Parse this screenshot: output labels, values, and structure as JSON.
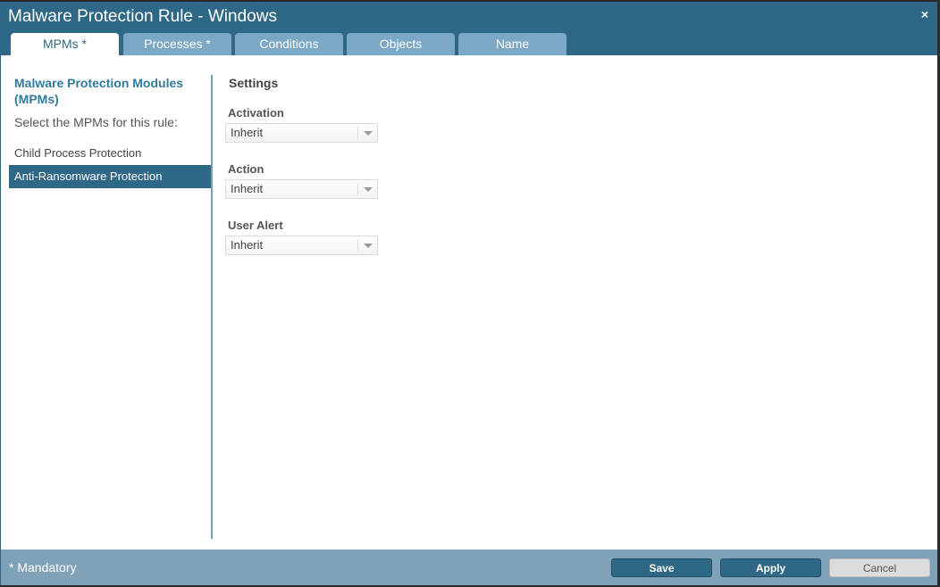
{
  "title": "Malware Protection Rule - Windows",
  "close": "×",
  "tabs": [
    "MPMs *",
    "Processes *",
    "Conditions",
    "Objects",
    "Name"
  ],
  "left": {
    "heading": "Malware Protection Modules (MPMs)",
    "subtitle": "Select the MPMs for this rule:",
    "items": [
      "Child Process Protection",
      "Anti-Ransomware Protection"
    ]
  },
  "settings": {
    "heading": "Settings",
    "fields": [
      {
        "label": "Activation",
        "value": "Inherit"
      },
      {
        "label": "Action",
        "value": "Inherit"
      },
      {
        "label": "User Alert",
        "value": "Inherit"
      }
    ]
  },
  "footer": {
    "mandatory": "* Mandatory",
    "save": "Save",
    "apply": "Apply",
    "cancel": "Cancel"
  }
}
